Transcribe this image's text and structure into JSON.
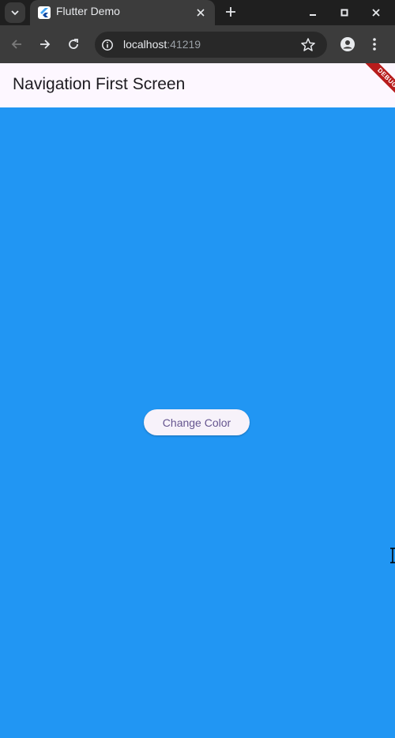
{
  "browser": {
    "tab": {
      "title": "Flutter Demo",
      "favicon": "flutter-logo-icon"
    },
    "address": {
      "host": "localhost",
      "port": ":41219"
    }
  },
  "app": {
    "appbar": {
      "title": "Navigation First Screen"
    },
    "debug_banner": "DEBUG",
    "button": {
      "label": "Change Color"
    },
    "colors": {
      "background": "#2196f3",
      "appbar": "#fdf7ff",
      "button_text": "#65558f"
    }
  }
}
